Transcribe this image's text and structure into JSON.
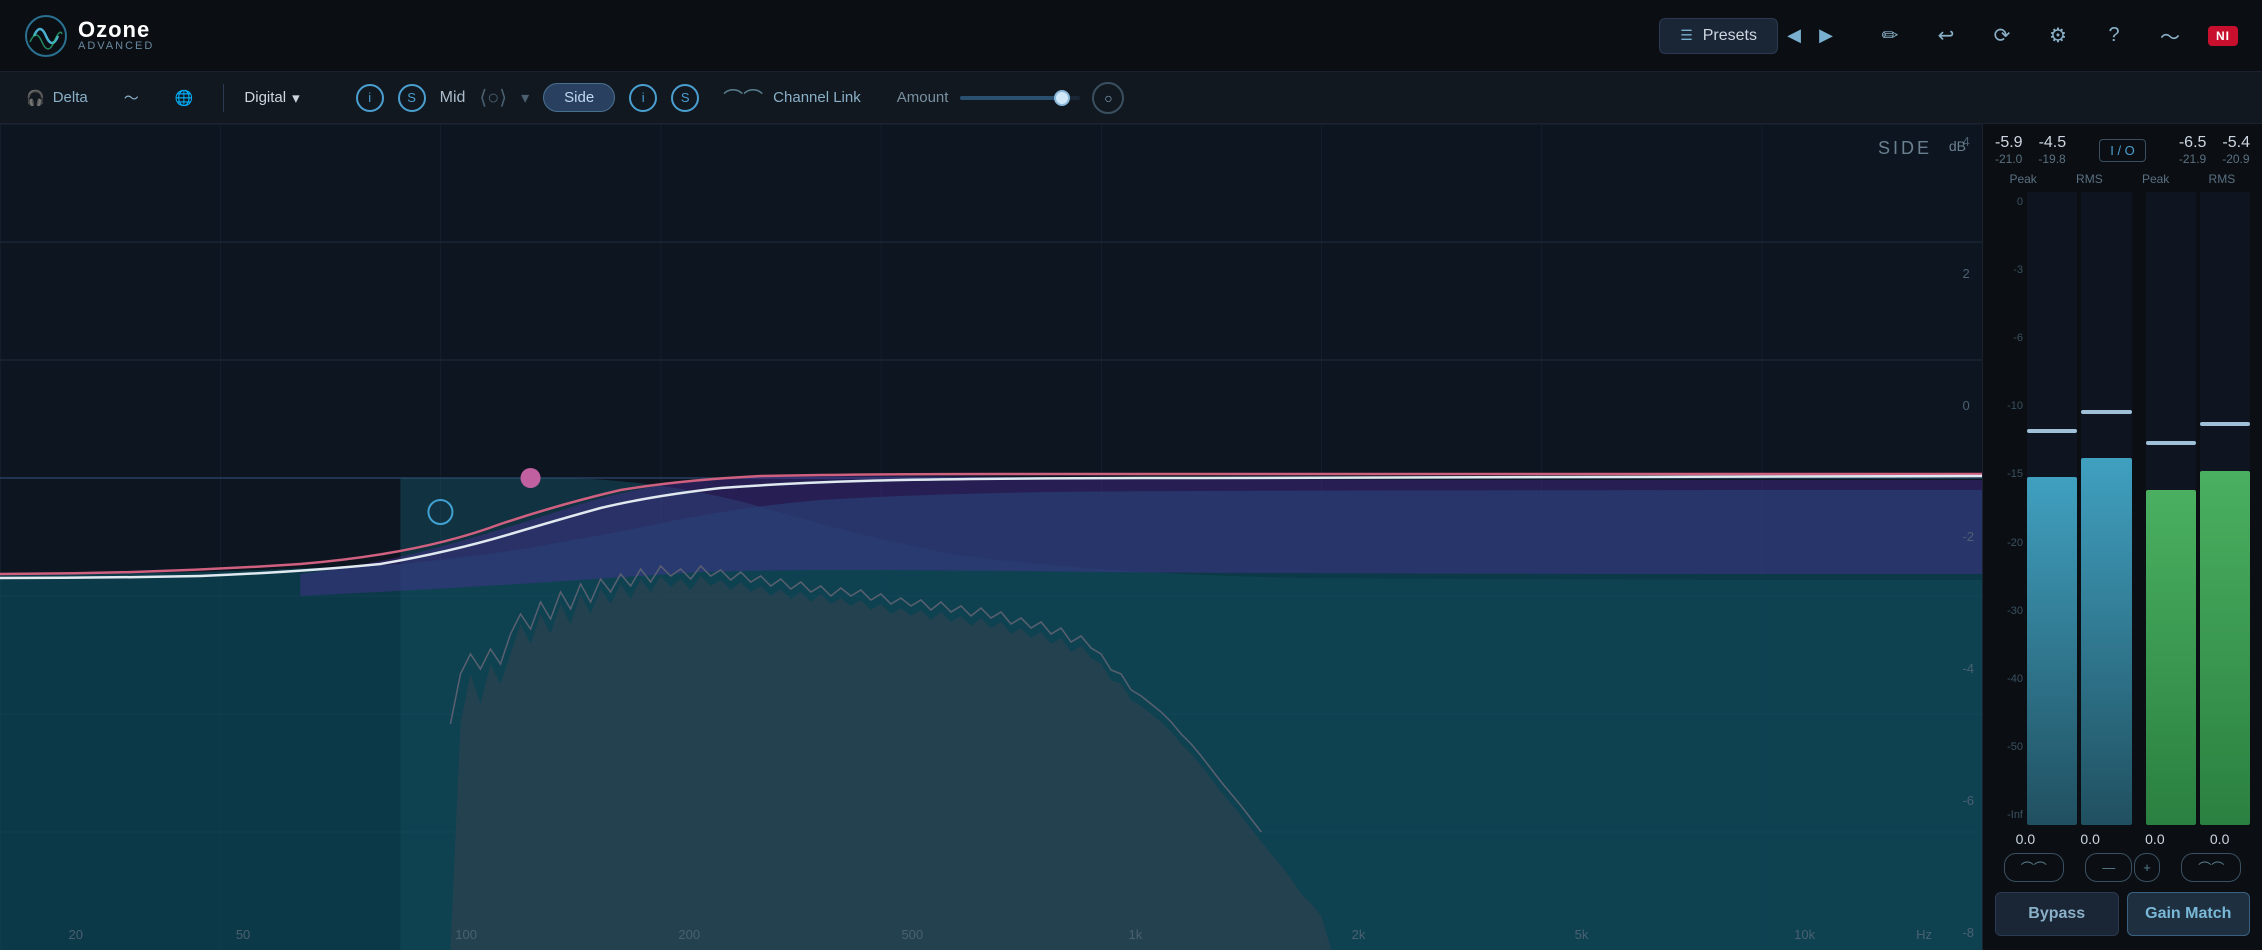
{
  "app": {
    "title": "Ozone",
    "subtitle": "ADVANCED",
    "ni_label": "NI"
  },
  "topbar": {
    "presets_label": "Presets",
    "pencil_icon": "✏",
    "undo_icon": "↩",
    "history_icon": "⏱",
    "settings_icon": "⚙",
    "help_icon": "?",
    "midi_icon": "🎹"
  },
  "secbar": {
    "delta_label": "Delta",
    "global_icon": "🌐",
    "digital_label": "Digital",
    "mid_label": "Mid",
    "side_label": "Side",
    "channel_link_label": "Channel Link",
    "amount_label": "Amount",
    "io_btn": "I/O",
    "mid_i_label": "i",
    "mid_s_label": "S",
    "side_i_label": "i",
    "side_s_label": "S",
    "slider_value": 80
  },
  "eq": {
    "side_label": "SIDE",
    "db_unit": "dB",
    "db_labels": [
      "4",
      "2",
      "0",
      "-2",
      "-4",
      "-6",
      "-8"
    ],
    "hz_labels": [
      "20",
      "50",
      "100",
      "200",
      "500",
      "1k",
      "2k",
      "5k",
      "10k"
    ],
    "hz_unit": "Hz"
  },
  "meters": {
    "io_label": "I / O",
    "left_peak_label": "—",
    "right_peak_label": "—",
    "peak_label": "Peak",
    "rms_label": "RMS",
    "left_peak_val": "-5.9",
    "right_peak_val": "-4.5",
    "left_rms_val": "-21.0",
    "right_rms_val": "-19.8",
    "out_peak_left": "-6.5",
    "out_peak_right": "-5.4",
    "out_rms_left": "-21.9",
    "out_rms_right": "-20.9",
    "scale": [
      "0",
      "-3",
      "-6",
      "-10",
      "-15",
      "-20",
      "-30",
      "-40",
      "-50",
      "-Inf"
    ],
    "bar_vals": [
      "0.0",
      "0.0",
      "0.0",
      "0.0"
    ],
    "bypass_label": "Bypass",
    "gain_match_label": "Gain Match"
  }
}
